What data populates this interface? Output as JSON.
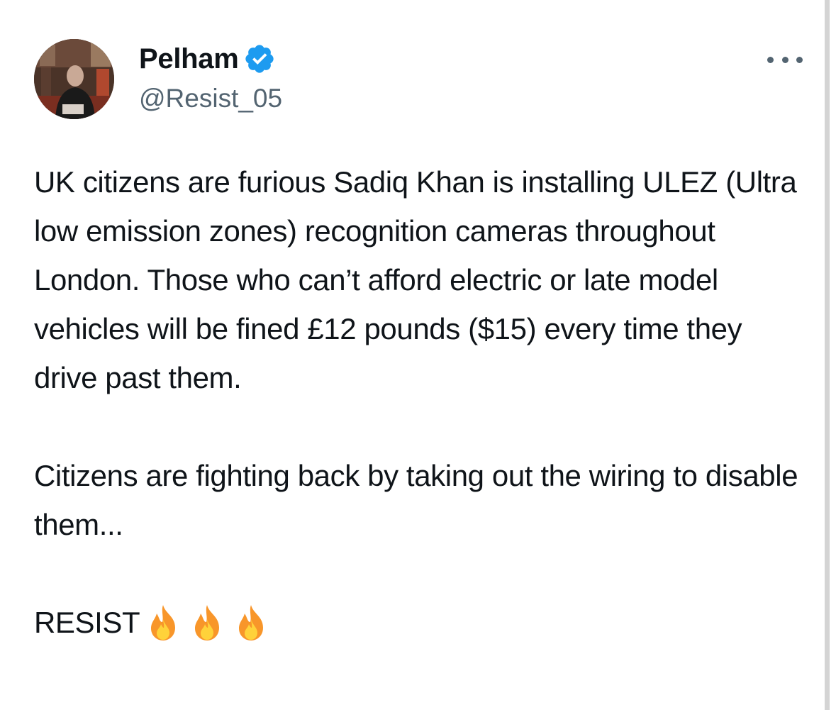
{
  "tweet": {
    "author": {
      "display_name": "Pelham",
      "handle": "@Resist_05",
      "verified": true,
      "verified_icon": "verified-badge-icon",
      "verified_color": "#1d9bf0"
    },
    "more_icon": "more-horizontal-icon",
    "body": {
      "paragraph_1": "UK citizens are furious Sadiq Khan is installing ULEZ (Ultra low emission zones) recognition cameras throughout London. Those who can’t afford electric or late model vehicles will be fined £12 pounds ($15) every time they drive past them.",
      "paragraph_2": "Citizens are fighting back by taking out the wiring to disable them...",
      "closing_word": "RESIST",
      "closing_emoji": [
        "fire-emoji",
        "fire-emoji",
        "fire-emoji"
      ]
    }
  },
  "colors": {
    "text_primary": "#0f1419",
    "text_secondary": "#536471",
    "accent": "#1d9bf0"
  }
}
